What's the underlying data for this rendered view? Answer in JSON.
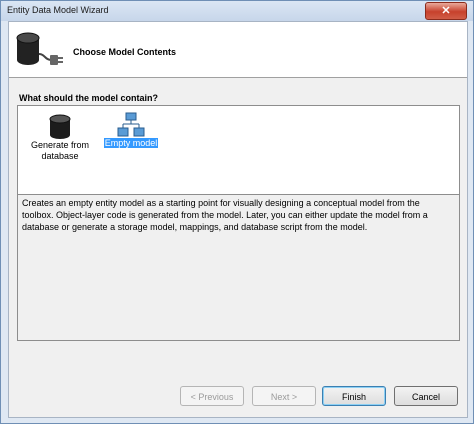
{
  "window": {
    "title": "Entity Data Model Wizard",
    "close_label": "✕"
  },
  "header": {
    "title": "Choose Model Contents"
  },
  "question": "What should the model contain?",
  "choices": [
    {
      "label": "Generate from database",
      "icon": "database-icon",
      "selected": false
    },
    {
      "label": "Empty model",
      "icon": "empty-model-icon",
      "selected": true
    }
  ],
  "description": "Creates an empty entity model as a starting point for visually designing a conceptual model from the toolbox. Object-layer code is generated from the model. Later, you can either update the model from a database or generate a storage model, mappings, and database script from the model.",
  "buttons": {
    "previous": "< Previous",
    "next": "Next >",
    "finish": "Finish",
    "cancel": "Cancel"
  },
  "colors": {
    "selection": "#3399ff",
    "frame": "#dfe8f3",
    "close": "#c7412c"
  }
}
